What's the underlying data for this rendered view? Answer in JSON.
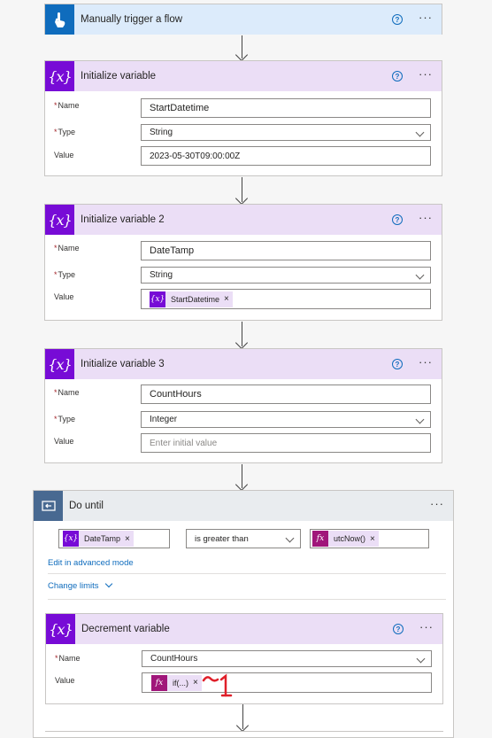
{
  "trigger": {
    "title": "Manually trigger a flow"
  },
  "init1": {
    "title": "Initialize variable",
    "name_label": "Name",
    "name_value": "StartDatetime",
    "type_label": "Type",
    "type_value": "String",
    "value_label": "Value",
    "value_value": "2023-05-30T09:00:00Z"
  },
  "init2": {
    "title": "Initialize variable 2",
    "name_label": "Name",
    "name_value": "DateTamp",
    "type_label": "Type",
    "type_value": "String",
    "value_label": "Value",
    "value_token": "StartDatetime"
  },
  "init3": {
    "title": "Initialize variable 3",
    "name_label": "Name",
    "name_value": "CountHours",
    "type_label": "Type",
    "type_value": "Integer",
    "value_label": "Value",
    "value_placeholder": "Enter initial value"
  },
  "dountil": {
    "title": "Do until",
    "left_token": "DateTamp",
    "operator": "is greater than",
    "right_token": "utcNow()",
    "edit_advanced": "Edit in advanced mode",
    "change_limits": "Change limits"
  },
  "decrement": {
    "title": "Decrement variable",
    "name_label": "Name",
    "name_value": "CountHours",
    "value_label": "Value",
    "value_token": "if(...)",
    "annotation": "1"
  },
  "icons": {
    "help": "?",
    "remove": "×",
    "variable": "{x}",
    "fx": "fx"
  },
  "colors": {
    "trigger": "#0f6cbd",
    "variable": "#770bd6",
    "loop": "#486991",
    "expression": "#a0167a",
    "annotation": "#e0202a"
  }
}
